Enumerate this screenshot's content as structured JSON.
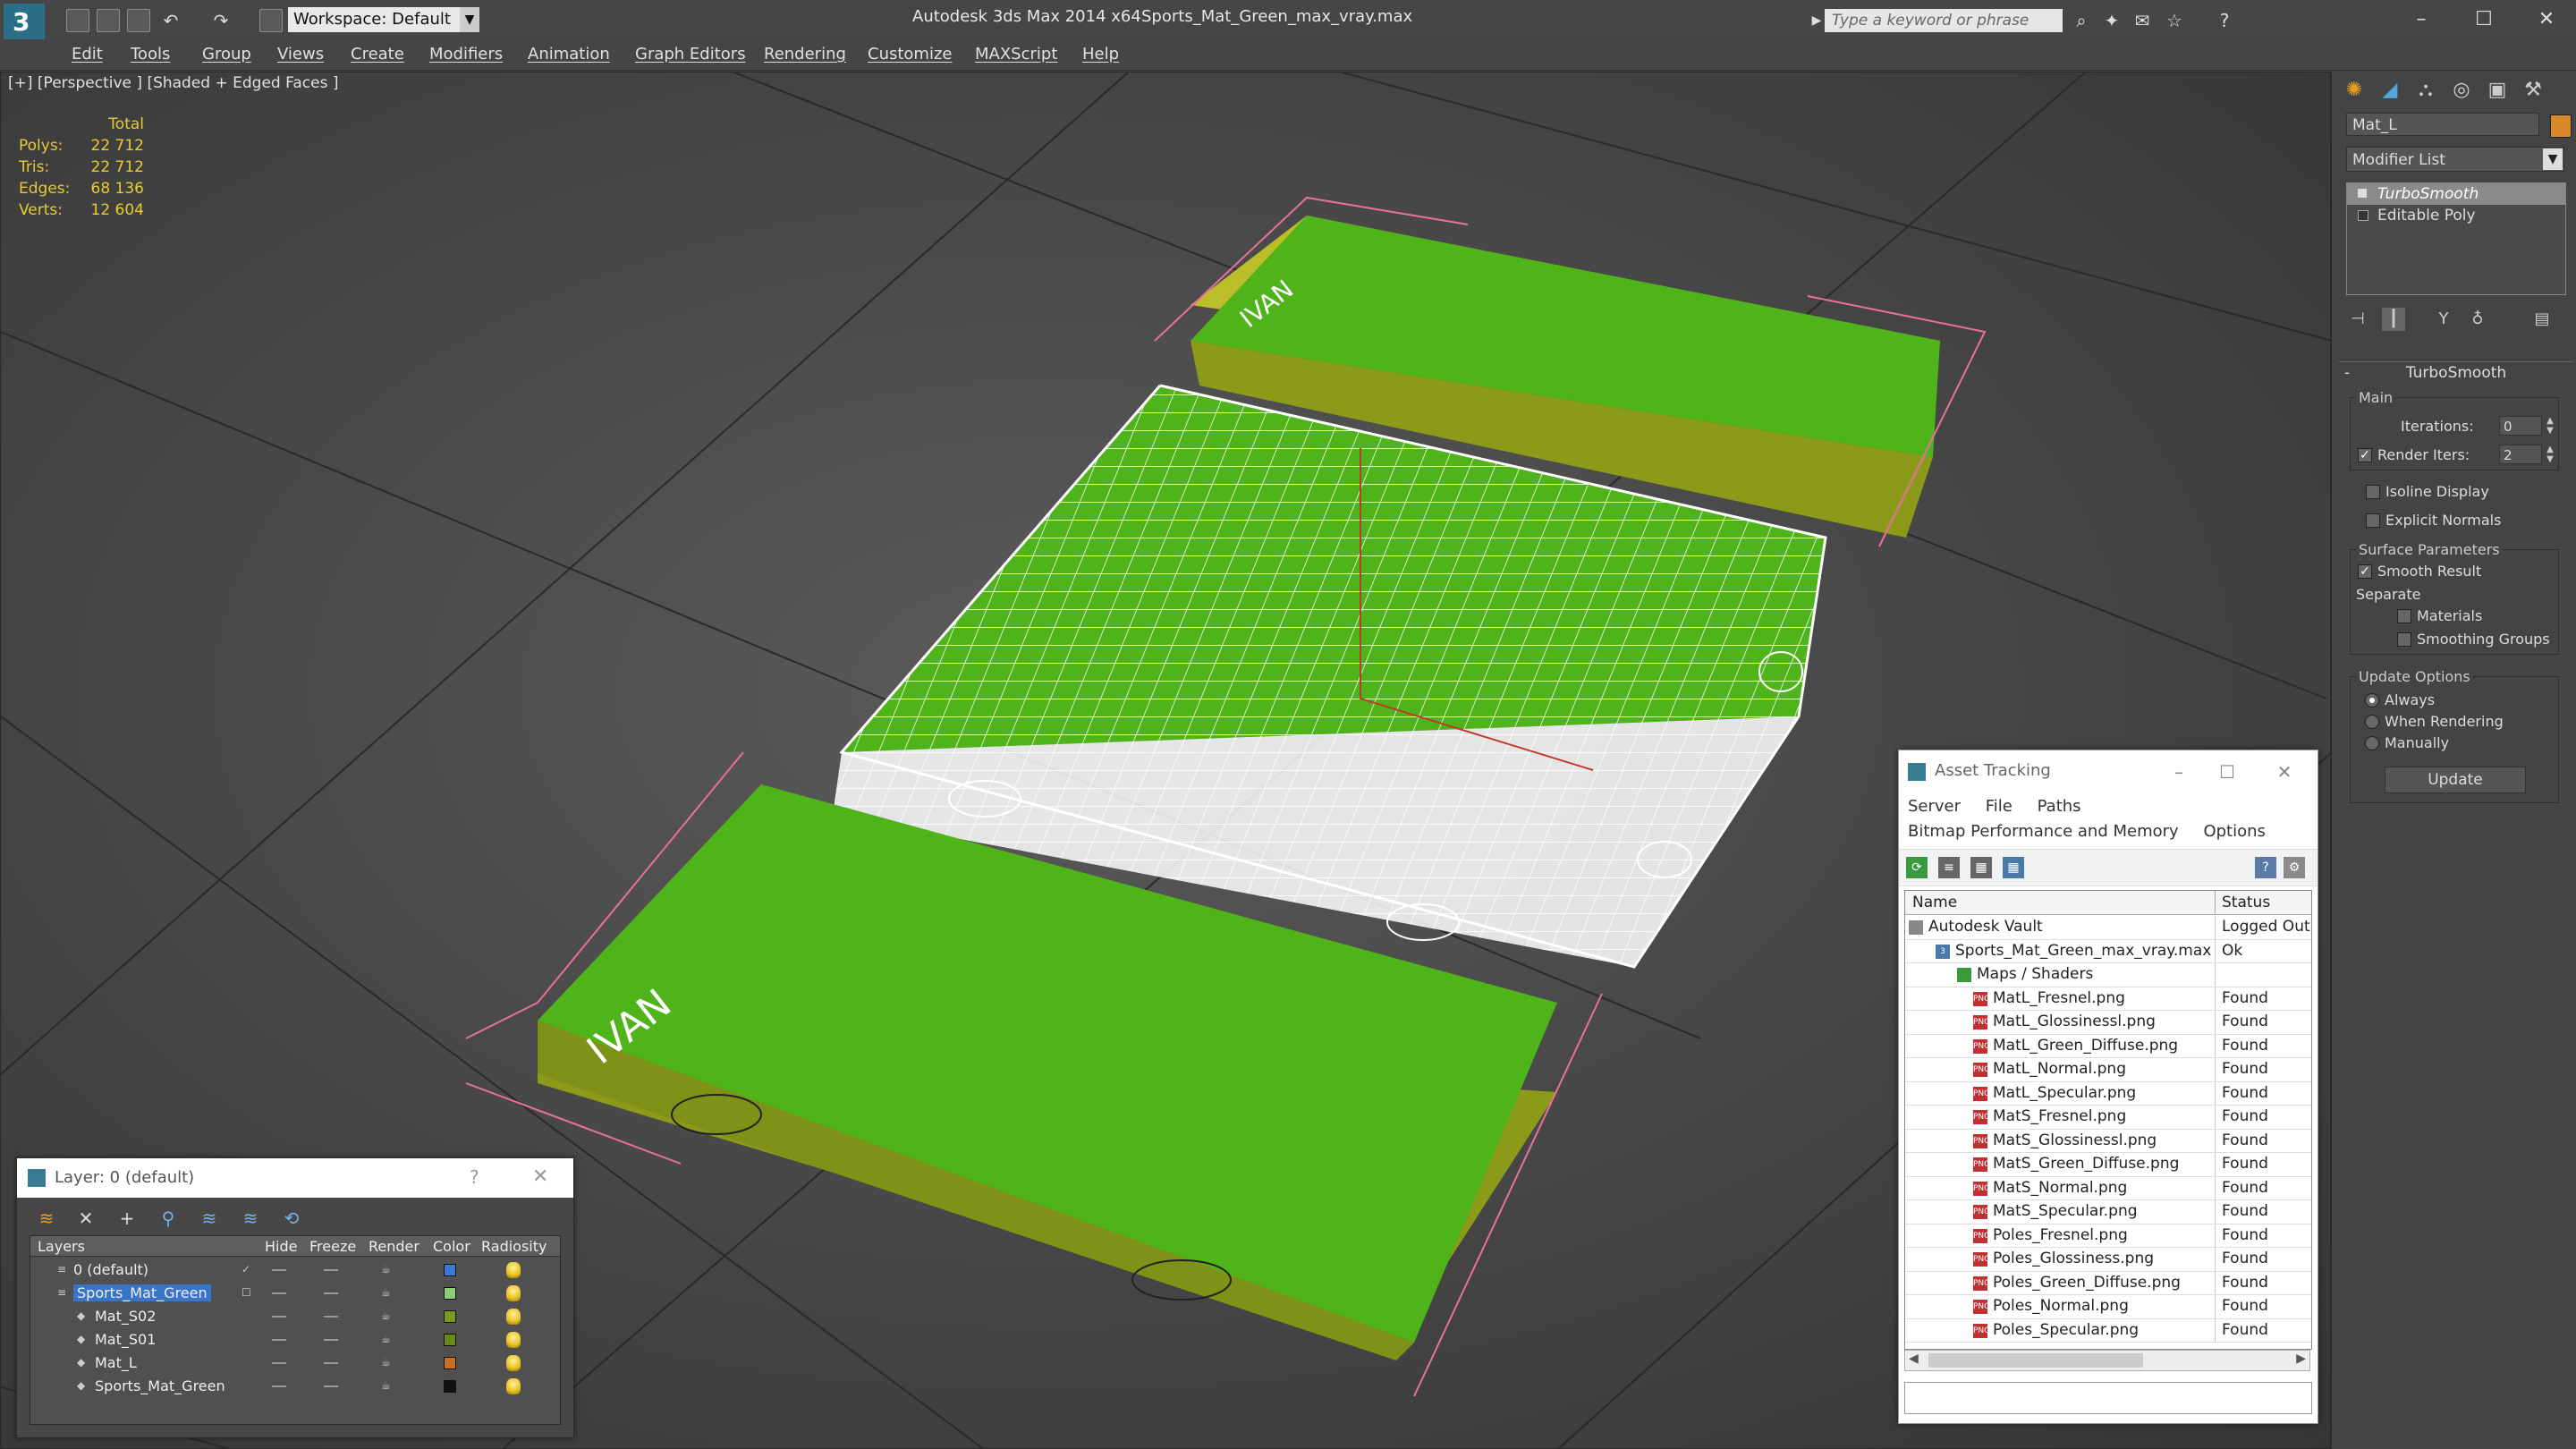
{
  "app": {
    "title": "Autodesk 3ds Max  2014 x64",
    "file": "Sports_Mat_Green_max_vray.max",
    "workspace": "Workspace: Default",
    "search_placeholder": "Type a keyword or phrase"
  },
  "menu": [
    "Edit",
    "Tools",
    "Group",
    "Views",
    "Create",
    "Modifiers",
    "Animation",
    "Graph Editors",
    "Rendering",
    "Customize",
    "MAXScript",
    "Help"
  ],
  "viewport": {
    "label": "[+] [Perspective ] [Shaded + Edged Faces ]",
    "stats": {
      "header": "Total",
      "rows": [
        {
          "k": "Polys:",
          "v": "22 712"
        },
        {
          "k": "Tris:",
          "v": "22 712"
        },
        {
          "k": "Edges:",
          "v": "68 136"
        },
        {
          "k": "Verts:",
          "v": "12 604"
        }
      ]
    }
  },
  "command_panel": {
    "object_name": "Mat_L",
    "modifier_list": "Modifier List",
    "stack": [
      "TurboSmooth",
      "Editable Poly"
    ],
    "rollout_title": "TurboSmooth",
    "main_label": "Main",
    "iterations_label": "Iterations:",
    "iterations_value": "0",
    "render_iters_label": "Render Iters:",
    "render_iters_value": "2",
    "isoline": "Isoline Display",
    "explicit_normals": "Explicit Normals",
    "surface_params": "Surface Parameters",
    "smooth_result": "Smooth Result",
    "separate": "Separate",
    "materials": "Materials",
    "smoothing_groups": "Smoothing Groups",
    "update_options": "Update Options",
    "always": "Always",
    "when_rendering": "When Rendering",
    "manually": "Manually",
    "update_button": "Update"
  },
  "asset_tracking": {
    "title": "Asset Tracking",
    "menu1": [
      "Server",
      "File",
      "Paths"
    ],
    "menu2": [
      "Bitmap Performance and Memory",
      "Options"
    ],
    "col_name": "Name",
    "col_status": "Status",
    "rows": [
      {
        "name": "Autodesk Vault",
        "status": "Logged Out"
      },
      {
        "name": "Sports_Mat_Green_max_vray.max",
        "status": "Ok"
      },
      {
        "name": "Maps / Shaders",
        "status": ""
      },
      {
        "name": "MatL_Fresnel.png",
        "status": "Found"
      },
      {
        "name": "MatL_Glossinessl.png",
        "status": "Found"
      },
      {
        "name": "MatL_Green_Diffuse.png",
        "status": "Found"
      },
      {
        "name": "MatL_Normal.png",
        "status": "Found"
      },
      {
        "name": "MatL_Specular.png",
        "status": "Found"
      },
      {
        "name": "MatS_Fresnel.png",
        "status": "Found"
      },
      {
        "name": "MatS_Glossinessl.png",
        "status": "Found"
      },
      {
        "name": "MatS_Green_Diffuse.png",
        "status": "Found"
      },
      {
        "name": "MatS_Normal.png",
        "status": "Found"
      },
      {
        "name": "MatS_Specular.png",
        "status": "Found"
      },
      {
        "name": "Poles_Fresnel.png",
        "status": "Found"
      },
      {
        "name": "Poles_Glossiness.png",
        "status": "Found"
      },
      {
        "name": "Poles_Green_Diffuse.png",
        "status": "Found"
      },
      {
        "name": "Poles_Normal.png",
        "status": "Found"
      },
      {
        "name": "Poles_Specular.png",
        "status": "Found"
      }
    ]
  },
  "layer_window": {
    "title": "Layer: 0 (default)",
    "help": "?",
    "columns": [
      "Layers",
      "Hide",
      "Freeze",
      "Render",
      "Color",
      "Radiosity"
    ],
    "rows": [
      {
        "name": "0 (default)",
        "color": "#3a78d8"
      },
      {
        "name": "Sports_Mat_Green",
        "color": "#8ad070"
      },
      {
        "name": "Mat_S02",
        "color": "#7a9a20"
      },
      {
        "name": "Mat_S01",
        "color": "#6a8a18"
      },
      {
        "name": "Mat_L",
        "color": "#c87020"
      },
      {
        "name": "Sports_Mat_Green",
        "color": "#101010"
      }
    ]
  },
  "colors": {
    "mat_green": "#4fb31a",
    "wire_white": "#ffffff",
    "bbox_pink": "#e86fa0",
    "selection_blue": "#3874c8",
    "stats_yellow": "#e6cc30"
  }
}
